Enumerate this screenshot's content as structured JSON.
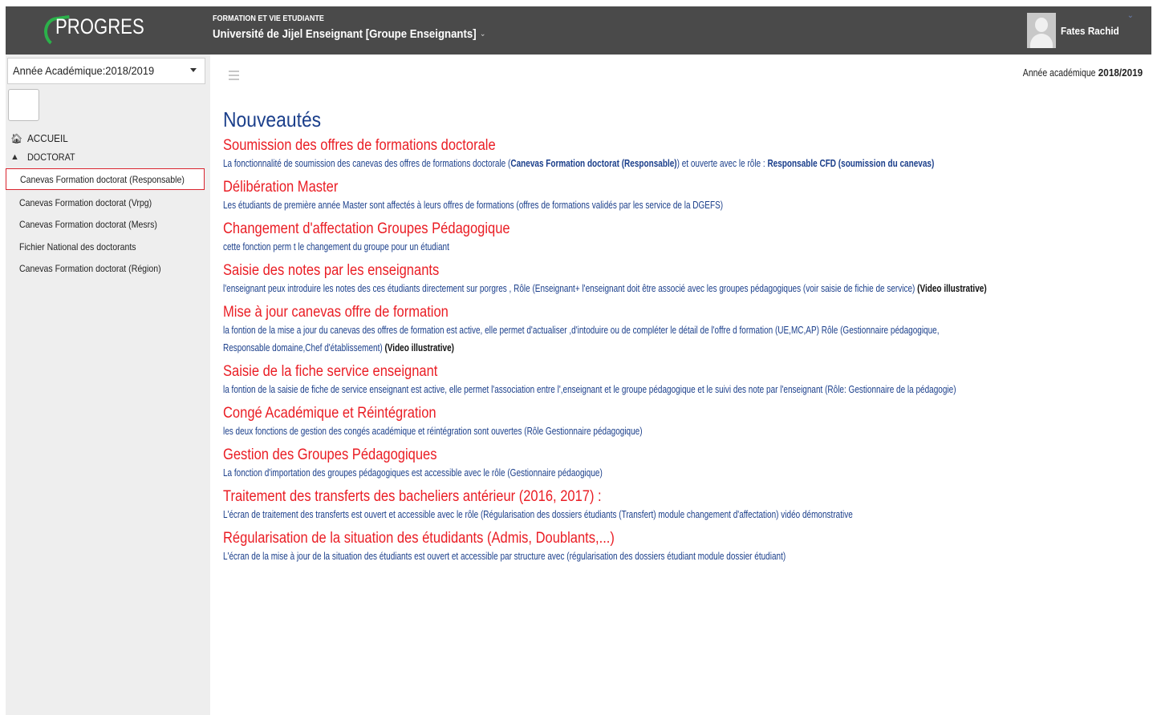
{
  "header": {
    "logo_text": "PROGRES",
    "subtitle": "FORMATION ET VIE ETUDIANTE",
    "title": "Université de Jijel Enseignant [Groupe Enseignants]",
    "user_name": "Fates Rachid",
    "colors": {
      "bar": "#4a4a4a",
      "logo_swoosh": "#2bb14a"
    }
  },
  "sidebar": {
    "year_select": "Année Académique:2018/2019",
    "nav": [
      {
        "label": "ACCUEIL",
        "icon": "home-icon"
      },
      {
        "label": "DOCTORAT",
        "icon": "graduation-cap-icon"
      }
    ],
    "items": [
      {
        "label": "Canevas Formation doctorat (Responsable)",
        "active": true
      },
      {
        "label": "Canevas Formation doctorat (Vrpg)"
      },
      {
        "label": "Canevas Formation doctorat (Mesrs)"
      },
      {
        "label": "Fichier National des doctorants"
      },
      {
        "label": "Canevas Formation doctorat (Région)"
      }
    ]
  },
  "main": {
    "year_prefix": "Année académique",
    "year_value": "2018/2019",
    "page_title": "Nouveautés",
    "news": [
      {
        "title": "Soumission des offres de formations doctorale",
        "desc_a": "La fonctionnalité de soumission des canevas des offres de formations doctorale (",
        "desc_b": "Canevas Formation doctorat (Responsable)",
        "desc_c": ") et ouverte avec le rôle : ",
        "desc_d": "Responsable CFD (soumission du canevas)"
      },
      {
        "title": "Délibération Master",
        "desc": "Les étudiants de première année Master sont affectés à leurs offres de formations (offres de formations validés par les service de la DGEFS)"
      },
      {
        "title": "Changement d'affectation Groupes Pédagogique",
        "desc": "cette fonction perm t le changement du groupe pour un étudiant"
      },
      {
        "title": "Saisie des notes par les enseignants",
        "desc": "l'enseignant peux introduire les notes des ces étudiants directement sur porgres , Rôle (Enseignant+ l'enseignant doit être associé avec les groupes pédagogiques (voir saisie de fichie de service) ",
        "video": "(Video illustrative)"
      },
      {
        "title": "Mise à jour canevas offre de formation",
        "desc": "la fontion de la mise a jour du canevas des offres de formation est active, elle permet d'actualiser ,d'intoduire ou de compléter le détail de l'offre d formation (UE,MC,AP) Rôle (Gestionnaire pédagogique,",
        "desc2": "Responsable domaine,Chef d'établissement) ",
        "video": "(Video illustrative)"
      },
      {
        "title": "Saisie de la fiche service enseignant",
        "desc": "la fontion de la saisie de fiche de service enseignant est active, elle permet l'association entre l',enseignant et le groupe pédagogique et le suivi des note par l'enseignant (Rôle: Gestionnaire de la pédagogie)"
      },
      {
        "title": "Congé Académique et Réintégration",
        "desc": "les deux fonctions de gestion des congés académique et réintégration sont ouvertes (Rôle Gestionnaire pédagogique)"
      },
      {
        "title": "Gestion des Groupes Pédagogiques",
        "desc": "La fonction d'importation des groupes pédagogiques est accessible avec le rôle (Gestionnaire pédaogique)"
      },
      {
        "title": "Traitement des transferts des bacheliers antérieur (2016, 2017) :",
        "desc": "L'écran de traitement des transferts est ouvert et accessible avec le rôle (Régularisation des dossiers étudiants (Transfert) module changement d'affectation) vidéo démonstrative"
      },
      {
        "title": "Régularisation de la situation des étudidants (Admis, Doublants,...)",
        "desc": "L'écran de la mise à jour de la situation des étudiants est ouvert et accessible par structure avec (régularisation des dossiers étudiant module dossier étudiant)"
      }
    ],
    "colors": {
      "title_blue": "#1b3f8b",
      "news_red": "#ea1d24",
      "active_border": "#d9232e"
    }
  }
}
